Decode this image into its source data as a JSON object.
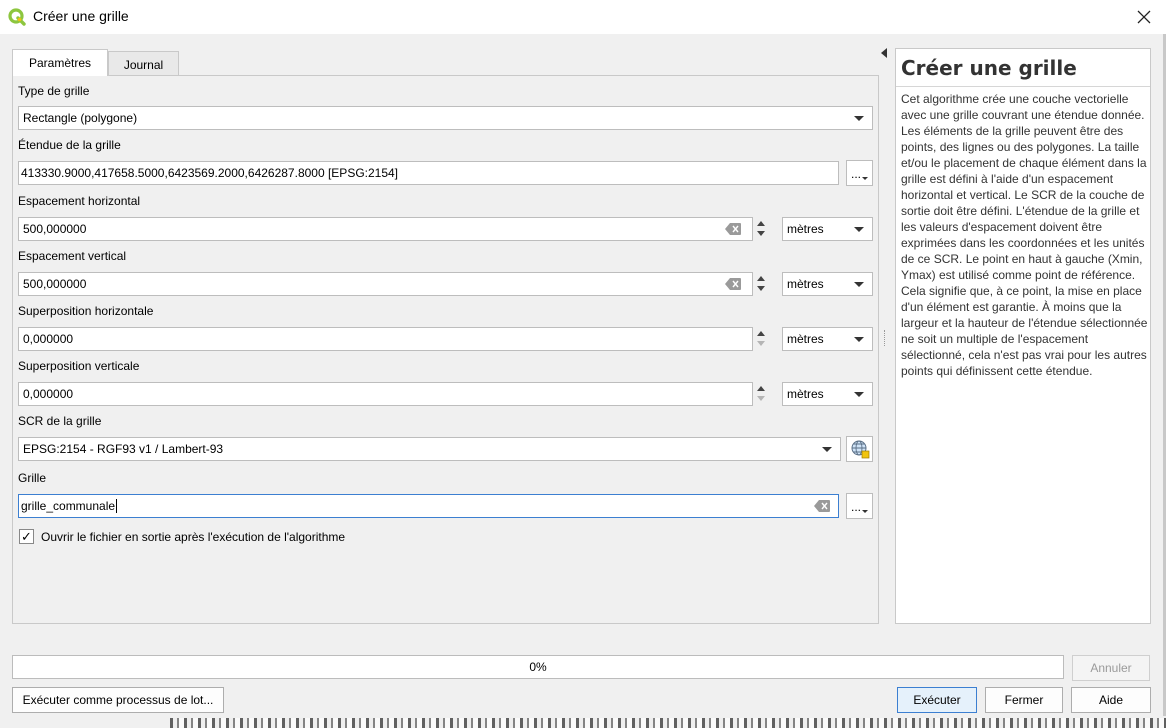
{
  "window": {
    "title": "Créer une grille"
  },
  "tabs": [
    {
      "label": "Paramètres"
    },
    {
      "label": "Journal"
    }
  ],
  "form": {
    "grid_type": {
      "label": "Type de grille",
      "value": "Rectangle (polygone)"
    },
    "extent": {
      "label": "Étendue de la grille",
      "value": "413330.9000,417658.5000,6423569.2000,6426287.8000 [EPSG:2154]",
      "button": "..."
    },
    "h_spacing": {
      "label": "Espacement horizontal",
      "value": "500,000000",
      "unit": "mètres"
    },
    "v_spacing": {
      "label": "Espacement vertical",
      "value": "500,000000",
      "unit": "mètres"
    },
    "h_overlay": {
      "label": "Superposition horizontale",
      "value": "0,000000",
      "unit": "mètres"
    },
    "v_overlay": {
      "label": "Superposition verticale",
      "value": "0,000000",
      "unit": "mètres"
    },
    "crs": {
      "label": "SCR de la grille",
      "value": "EPSG:2154 - RGF93 v1 / Lambert-93"
    },
    "output": {
      "label": "Grille",
      "value": "grille_communale",
      "button": "..."
    },
    "open_output": {
      "label": "Ouvrir le fichier en sortie après l'exécution de l'algorithme",
      "checked": true,
      "mark": "✓"
    }
  },
  "help": {
    "title": "Créer une grille",
    "text": "Cet algorithme crée une couche vectorielle avec une grille couvrant une étendue donnée. Les éléments de la grille peuvent être des points, des lignes ou des polygones. La taille et/ou le placement de chaque élément dans la grille est défini à l'aide d'un espacement horizontal et vertical. Le SCR de la couche de sortie doit être défini. L'étendue de la grille et les valeurs d'espacement doivent être exprimées dans les coordonnées et les unités de ce SCR. Le point en haut à gauche (Xmin, Ymax) est utilisé comme point de référence. Cela signifie que, à ce point, la mise en place d'un élément est garantie. À moins que la largeur et la hauteur de l'étendue sélectionnée ne soit un multiple de l'espacement sélectionné, cela n'est pas vrai pour les autres points qui définissent cette étendue."
  },
  "progress": {
    "label": "0%",
    "value": 0
  },
  "buttons": {
    "cancel": "Annuler",
    "batch": "Exécuter comme processus de lot...",
    "run": "Exécuter",
    "close": "Fermer",
    "help": "Aide"
  },
  "colors": {
    "accent": "#3c7fd1",
    "logo_green": "#8dc63f",
    "logo_yellow": "#f1c40f"
  }
}
